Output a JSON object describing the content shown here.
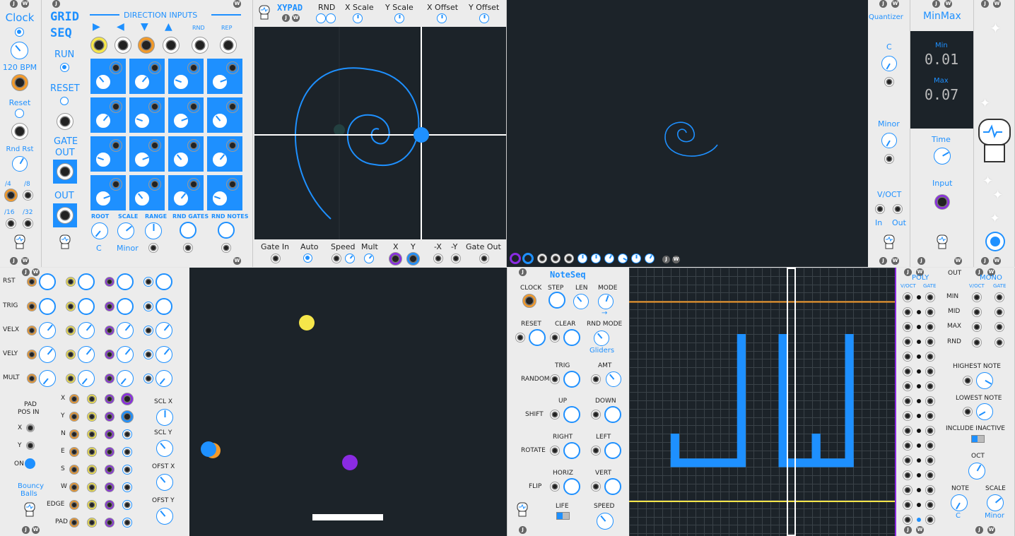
{
  "clock": {
    "title": "Clock",
    "bpm": "120 BPM",
    "reset": "Reset",
    "rnd_rst": "Rnd Rst",
    "div4": "/4",
    "div8": "/8",
    "div16": "/16",
    "div32": "/32"
  },
  "grid": {
    "title1": "GRID",
    "title2": "SEQ",
    "dir_inputs": "DIRECTION INPUTS",
    "rnd": "RND",
    "rep": "REP",
    "run": "RUN",
    "reset": "RESET",
    "gate1": "GATE",
    "gate2": "OUT",
    "out": "OUT",
    "root": "ROOT",
    "scale": "SCALE",
    "range": "RANGE",
    "rnd_gates": "RND GATES",
    "rnd_notes": "RND NOTES",
    "root_val": "C",
    "scale_val": "Minor"
  },
  "xypad": {
    "title": "XYPAD",
    "rnd": "RND",
    "xscale": "X Scale",
    "yscale": "Y Scale",
    "xoff": "X Offset",
    "yoff": "Y Offset",
    "gate_in": "Gate In",
    "auto": "Auto",
    "speed": "Speed",
    "mult": "Mult",
    "x": "X",
    "y": "Y",
    "nx": "-X",
    "ny": "-Y",
    "gate_out": "Gate Out"
  },
  "quant": {
    "title": "Quantizer",
    "root": "C",
    "scale": "Minor",
    "voct": "V/OCT",
    "in": "In",
    "out": "Out"
  },
  "minmax": {
    "title": "MinMax",
    "min_label": "Min",
    "min_val": "0.01",
    "max_label": "Max",
    "max_val": "0.07",
    "time": "Time",
    "input": "Input"
  },
  "balls": {
    "rst": "RST",
    "trig": "TRIG",
    "velx": "VELX",
    "vely": "VELY",
    "mult": "MULT",
    "x": "X",
    "y": "Y",
    "n": "N",
    "e": "E",
    "s": "S",
    "w": "W",
    "edge": "EDGE",
    "pad": "PAD",
    "pad_pos": "PAD",
    "pos_in": "POS IN",
    "px": "X",
    "py": "Y",
    "on": "ON",
    "name1": "Bouncy",
    "name2": "Balls",
    "sclx": "SCL X",
    "scly": "SCL Y",
    "ofstx": "OFST X",
    "ofsty": "OFST Y"
  },
  "noteseq": {
    "title": "NoteSeq",
    "clock": "CLOCK",
    "step": "STEP",
    "len": "LEN",
    "mode": "MODE",
    "reset": "RESET",
    "clear": "CLEAR",
    "rnd_mode": "RND MODE",
    "gliders": "Gliders",
    "trig": "TRIG",
    "amt": "AMT",
    "random": "RANDOM",
    "up": "UP",
    "down": "DOWN",
    "shift": "SHIFT",
    "right": "RIGHT",
    "left": "LEFT",
    "rotate": "ROTATE",
    "horiz": "HORIZ",
    "vert": "VERT",
    "flip": "FLIP",
    "life": "LIFE",
    "speed": "SPEED",
    "arrow": "→"
  },
  "noteout": {
    "out": "OUT",
    "poly": "POLY",
    "mono": "MONO",
    "voct": "V/OCT",
    "gate": "GATE",
    "min": "MIN",
    "mid": "MID",
    "max": "MAX",
    "rnd": "RND",
    "highest": "HIGHEST NOTE",
    "lowest": "LOWEST NOTE",
    "include": "INCLUDE INACTIVE",
    "oct": "OCT",
    "note": "NOTE",
    "scale": "SCALE",
    "note_val": "C",
    "scale_val": "Minor"
  },
  "colors": {
    "accent": "#1e90ff",
    "orange": "#f39a2a",
    "yellow": "#f5e64a",
    "purple": "#8a2be2",
    "dark": "#1c2329"
  }
}
